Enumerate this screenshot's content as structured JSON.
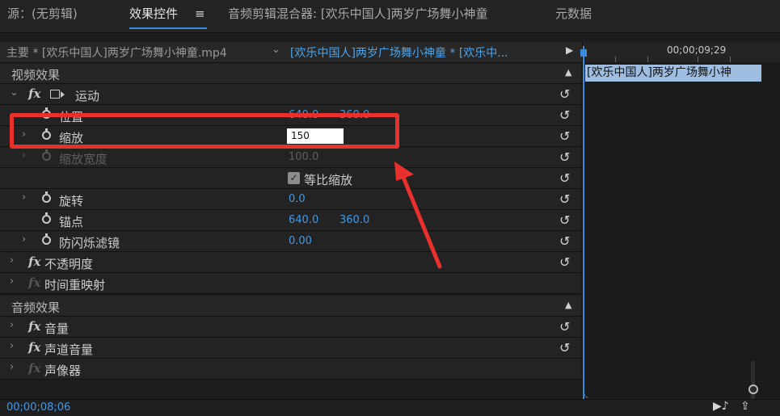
{
  "tabs": {
    "source": "源：(无剪辑)",
    "effect_controls": "效果控件",
    "menu_icon": "≡",
    "audio_mixer": "音频剪辑混合器: [欢乐中国人]两岁广场舞小神童",
    "metadata": "元数据"
  },
  "header": {
    "master_clip": "主要 * [欢乐中国人]两岁广场舞小神童.mp4",
    "dropdown_icon": "chevron-down-icon",
    "sequence_clip": "[欢乐中国人]两岁广场舞小神童 * [欢乐中...",
    "play_icon": "play-icon"
  },
  "sections": {
    "video_effects": "视频效果",
    "audio_effects": "音频效果"
  },
  "effects": {
    "motion": "运动",
    "position": {
      "label": "位置",
      "x": "640.0",
      "y": "360.0"
    },
    "scale": {
      "label": "缩放",
      "value": "150"
    },
    "scale_width": {
      "label": "缩放宽度",
      "value": "100.0"
    },
    "uniform_scale": {
      "label": "等比缩放",
      "checked": true
    },
    "rotation": {
      "label": "旋转",
      "value": "0.0"
    },
    "anchor": {
      "label": "锚点",
      "x": "640.0",
      "y": "360.0"
    },
    "anti_flicker": {
      "label": "防闪烁滤镜",
      "value": "0.00"
    },
    "opacity": "不透明度",
    "time_remap": "时间重映射",
    "volume": "音量",
    "channel_volume": "声道音量",
    "panner": "声像器",
    "fx_label": "fx"
  },
  "timeline": {
    "ruler_time": "00;00;09;29",
    "clip_label": "[欢乐中国人]两岁广场舞小神"
  },
  "bottom": {
    "timecode": "00;00;08;06"
  },
  "colors": {
    "accent_blue": "#3f9ae8",
    "annotation_red": "#e8302c",
    "clip_bar": "#9fbde0",
    "panel_bg": "#232323"
  }
}
